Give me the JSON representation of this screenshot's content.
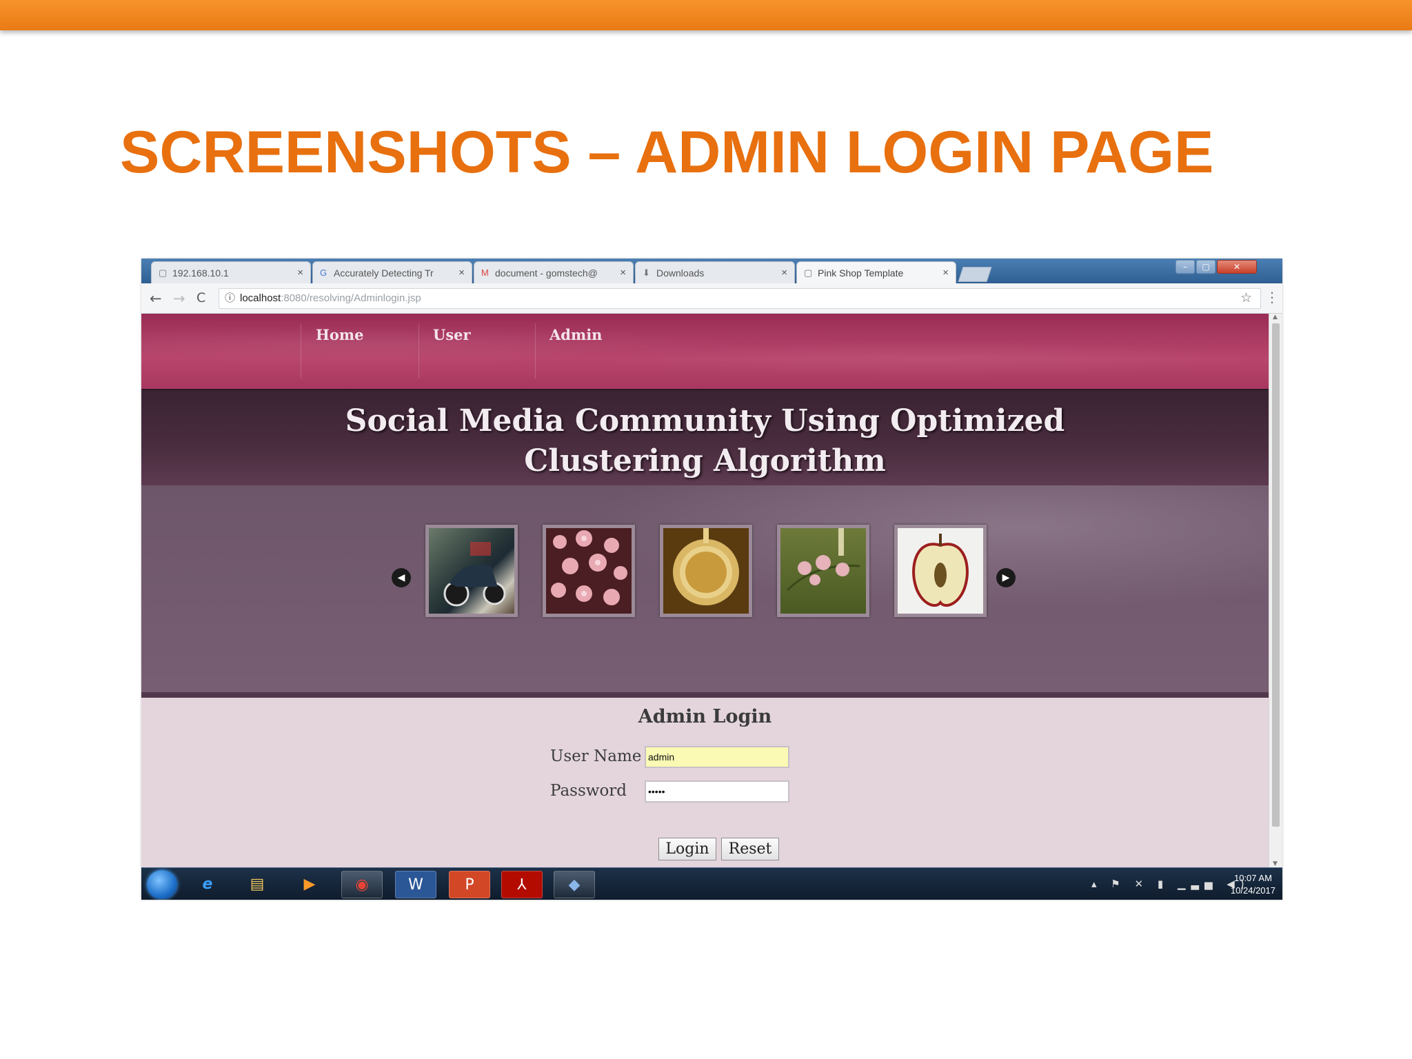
{
  "slide": {
    "title": "SCREENSHOTS – ADMIN LOGIN PAGE",
    "accent_color": "#e8700f"
  },
  "browser": {
    "tabs": [
      {
        "label": "192.168.10.1",
        "icon": "page-icon"
      },
      {
        "label": "Accurately Detecting Tr",
        "icon": "google-icon"
      },
      {
        "label": "document - gomstech@",
        "icon": "gmail-icon"
      },
      {
        "label": "Downloads",
        "icon": "download-icon"
      },
      {
        "label": "Pink Shop Template",
        "icon": "page-icon"
      }
    ],
    "active_tab": 4,
    "url_host": "localhost",
    "url_path": ":8080/resolving/Adminlogin.jsp"
  },
  "site": {
    "nav": [
      "Home",
      "User",
      "Admin"
    ],
    "title_line1": "Social Media Community Using Optimized",
    "title_line2": "Clustering Algorithm",
    "gallery": [
      "scooter-image",
      "cherry-blossom-image",
      "coffee-cup-image",
      "orchid-image",
      "apple-image"
    ],
    "login": {
      "heading": "Admin Login",
      "username_label": "User Name",
      "username_value": "admin",
      "password_label": "Password",
      "password_value": "•••••",
      "login_button": "Login",
      "reset_button": "Reset"
    }
  },
  "taskbar": {
    "apps": [
      "ie-icon",
      "explorer-icon",
      "media-player-icon",
      "chrome-icon",
      "word-icon",
      "powerpoint-icon",
      "acrobat-icon",
      "virtualbox-icon"
    ],
    "time": "10:07 AM",
    "date": "10/24/2017"
  }
}
